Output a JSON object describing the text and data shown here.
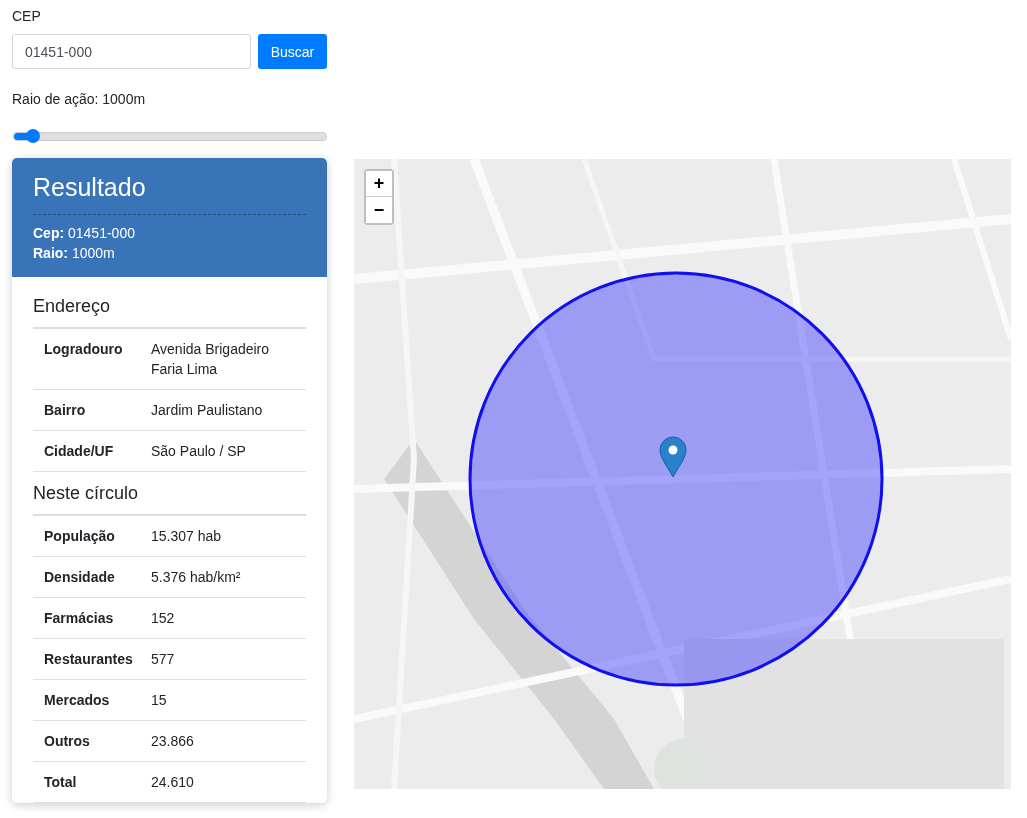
{
  "search": {
    "label": "CEP",
    "value": "01451-000",
    "button": "Buscar"
  },
  "radius": {
    "label": "Raio de ação: 1000m",
    "level": 0.06
  },
  "result": {
    "title": "Resultado",
    "lines": [
      "**Cep:** 01451-000",
      "**Raio:** 1000m"
    ],
    "sections": [
      {
        "title": "Endereço",
        "rows": [
          {
            "label": "Logradouro",
            "value": "Avenida Brigadeiro Faria Lima"
          },
          {
            "label": "Bairro",
            "value": "Jardim Paulistano"
          },
          {
            "label": "Cidade/UF",
            "value": "São Paulo / SP"
          }
        ]
      },
      {
        "title": "Neste círculo",
        "rows": [
          {
            "label": "População",
            "value": "15.307 hab"
          },
          {
            "label": "Densidade",
            "value": "5.376 hab/km²"
          },
          {
            "label": "Farmácias",
            "value": "152"
          },
          {
            "label": "Restaurantes",
            "value": "577"
          },
          {
            "label": "Mercados",
            "value": "15"
          },
          {
            "label": "Outros",
            "value": "23.866"
          },
          {
            "label": "Total",
            "value": "24.610"
          }
        ]
      }
    ]
  },
  "map": {
    "kind": "picture",
    "zoom": [
      "+",
      "−"
    ]
  }
}
